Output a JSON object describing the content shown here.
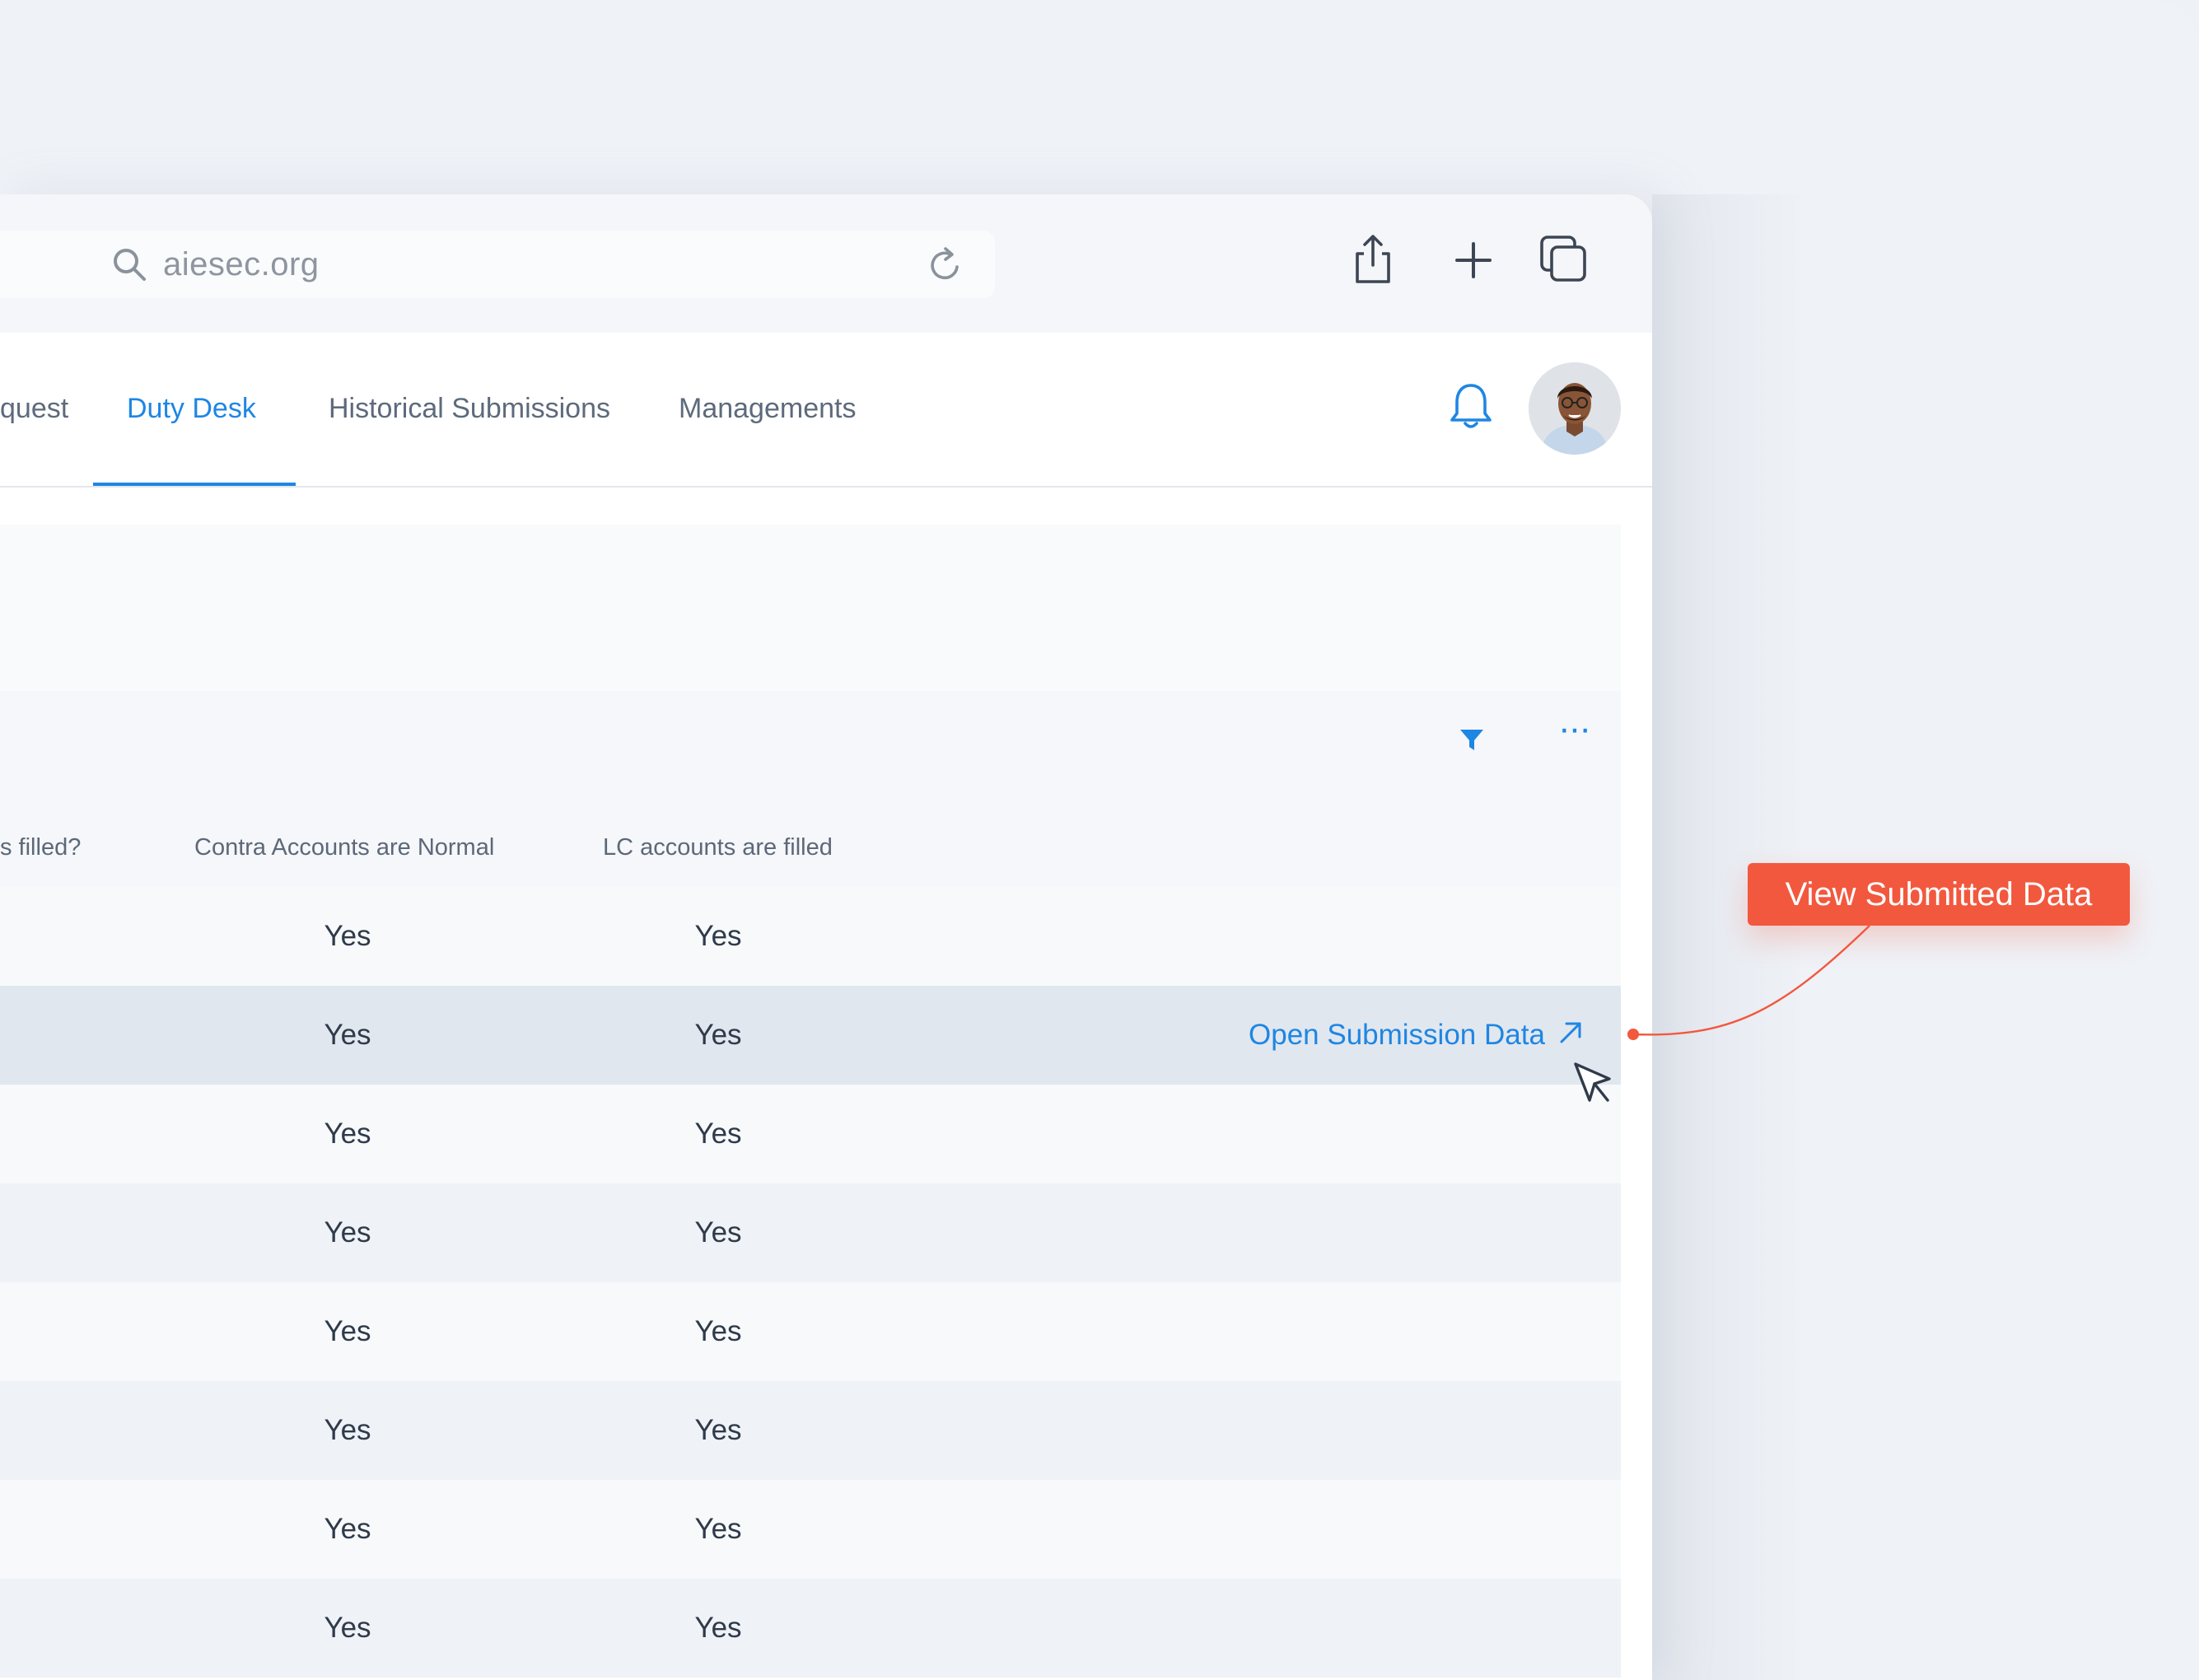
{
  "browser": {
    "url": "aiesec.org"
  },
  "nav": {
    "tabs": [
      {
        "label": "quest"
      },
      {
        "label": "Duty Desk"
      },
      {
        "label": "Historical Submissions"
      },
      {
        "label": "Managements"
      }
    ],
    "active_tab": "Duty Desk"
  },
  "table": {
    "columns": [
      {
        "label": "s filled?"
      },
      {
        "label": "Contra Accounts are Normal"
      },
      {
        "label": "LC accounts are filled"
      }
    ],
    "rows": [
      {
        "contra": "Yes",
        "lc": "Yes"
      },
      {
        "contra": "Yes",
        "lc": "Yes",
        "action": "Open Submission Data"
      },
      {
        "contra": "Yes",
        "lc": "Yes"
      },
      {
        "contra": "Yes",
        "lc": "Yes"
      },
      {
        "contra": "Yes",
        "lc": "Yes"
      },
      {
        "contra": "Yes",
        "lc": "Yes"
      },
      {
        "contra": "Yes",
        "lc": "Yes"
      },
      {
        "contra": "Yes",
        "lc": "Yes"
      }
    ]
  },
  "callout": {
    "label": "View Submitted Data"
  },
  "icons": {
    "toolbar": [
      "search-icon",
      "reload-icon",
      "share-icon",
      "plus-icon",
      "tabs-icon"
    ],
    "app": [
      "bell-icon",
      "avatar",
      "filter-icon",
      "more-icon",
      "external-link-icon",
      "cursor-icon"
    ]
  },
  "colors": {
    "accent": "#1e86e3",
    "callout": "#f2583e",
    "text": "#2f3a4a",
    "muted": "#5d6a7c"
  }
}
